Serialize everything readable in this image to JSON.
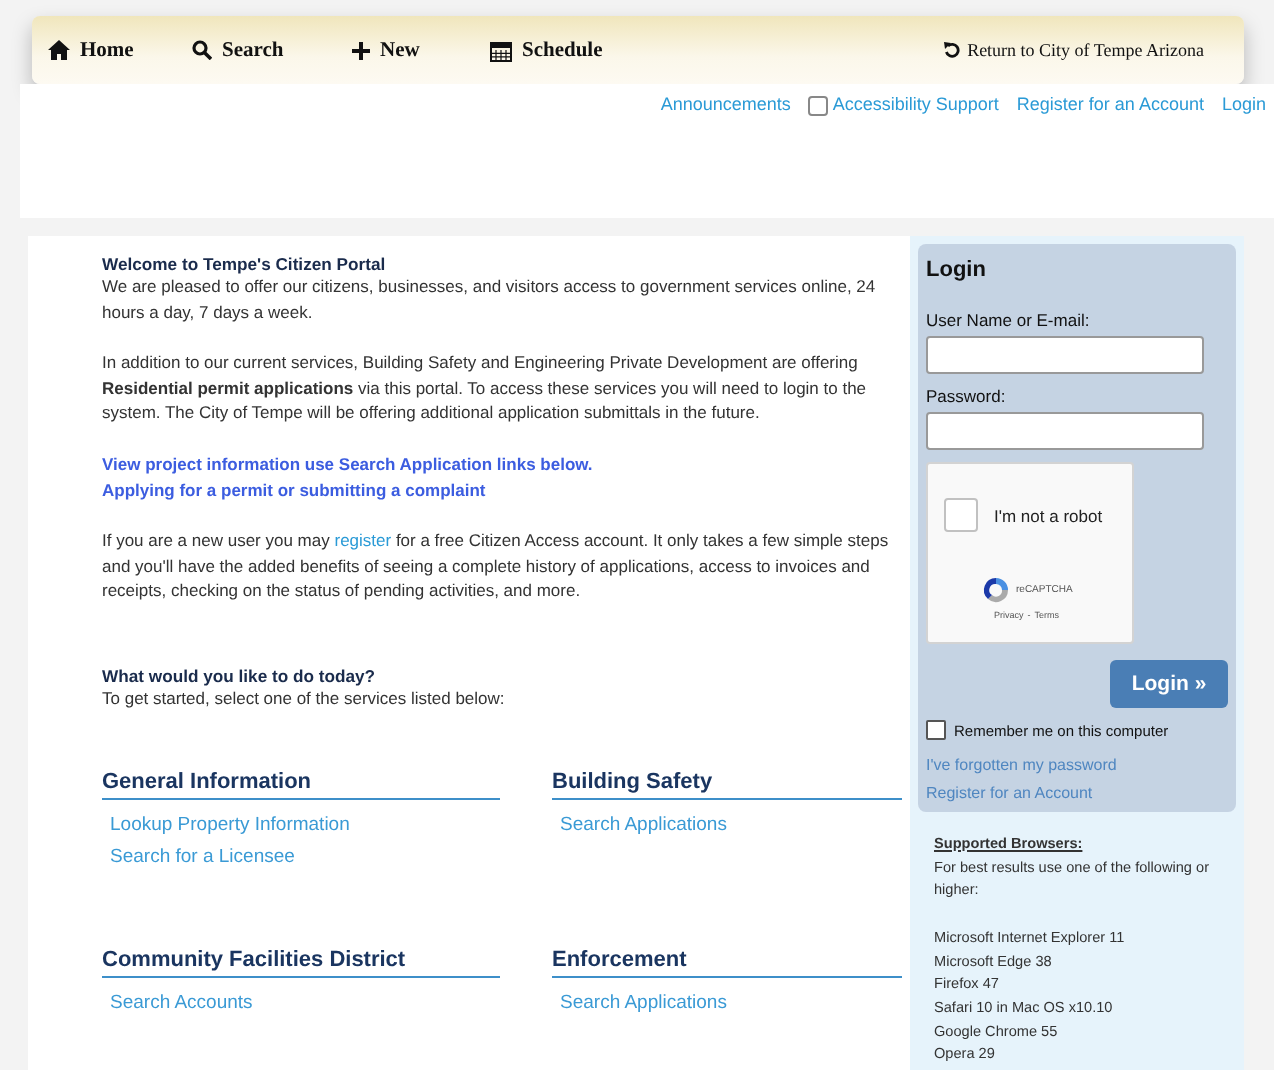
{
  "nav": {
    "items": [
      {
        "kind": "home",
        "label": "Home"
      },
      {
        "kind": "search",
        "label": "Search"
      },
      {
        "kind": "new",
        "label": "New"
      },
      {
        "kind": "schedule",
        "label": "Schedule"
      }
    ],
    "return_link": "Return to City of Tempe Arizona"
  },
  "top_links": {
    "announcements": "Announcements",
    "accessibility": {
      "label": "Accessibility Support",
      "checked": false
    },
    "register": "Register for an Account",
    "login": "Login"
  },
  "welcome": {
    "title": "Welcome to Tempe's Citizen Portal",
    "paragraphs": [
      "We are pleased to offer our citizens, businesses, and visitors access to government services online, 24 hours a day, 7 days a week.",
      "In addition to our current services, Building Safety and Engineering Private Development are offering **Residential permit applications** via this portal.  To access these services you will need to login to the system.  The City of Tempe will be offering additional application submittals in the future."
    ],
    "links": [
      "View project information use Search Application links below.",
      "Applying for a permit or submitting a complaint"
    ],
    "register_note": {
      "before": "If you are a new user you may ",
      "link": "register",
      "after": " for a free Citizen Access account. It only takes a few simple steps and you'll have the added benefits of seeing a complete history of applications, access to invoices and receipts, checking on the status of pending activities, and more."
    }
  },
  "services": {
    "title": "What would you like to do today?",
    "subtitle": "To get started, select one of the services listed below:",
    "sections": [
      {
        "title": "General Information",
        "links": [
          "Lookup Property Information",
          "Search for a Licensee"
        ]
      },
      {
        "title": "Building Safety",
        "links": [
          "Search Applications"
        ]
      },
      {
        "title": "Community Facilities District",
        "links": [
          "Search Accounts"
        ]
      },
      {
        "title": "Enforcement",
        "links": [
          "Search Applications"
        ]
      }
    ]
  },
  "login": {
    "title": "Login",
    "username_label": "User Name or E-mail:",
    "password_label": "Password:",
    "captcha": {
      "label": "I'm not a robot",
      "checked": false,
      "brand": "reCAPTCHA",
      "privacy": "Privacy",
      "separator": "-",
      "terms": "Terms"
    },
    "button": "Login »",
    "remember": {
      "label": "Remember me on this computer",
      "checked": false
    },
    "links": [
      "I've forgotten my password",
      "Register for an Account"
    ]
  },
  "browsers": {
    "title": "Supported Browsers:",
    "intro": "For best results use one of the following or higher:",
    "list": [
      "Microsoft Internet Explorer 11",
      "Microsoft Edge 38",
      "Firefox 47",
      "Safari 10 in Mac OS x10.10",
      "Google Chrome 55",
      "Opera 29"
    ]
  }
}
